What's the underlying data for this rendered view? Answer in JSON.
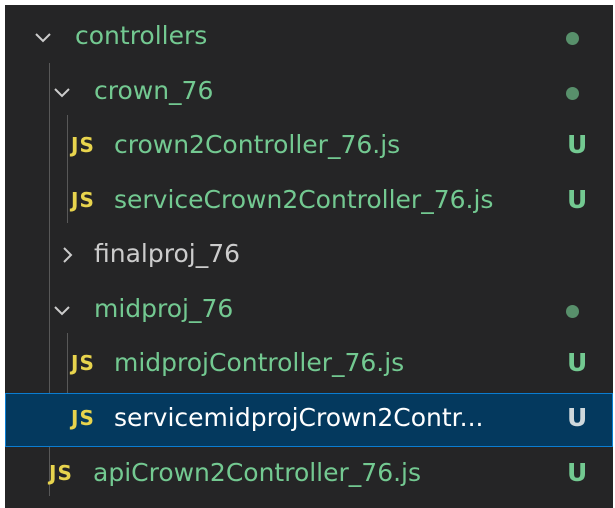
{
  "explorer": {
    "rows": [
      {
        "label": "controllers",
        "kind": "folder",
        "state": "expanded",
        "decoration": "dot"
      },
      {
        "label": "crown_76",
        "kind": "folder",
        "state": "expanded",
        "decoration": "dot"
      },
      {
        "icon": "JS",
        "label": "crown2Controller_76.js",
        "kind": "file",
        "decoration": "U"
      },
      {
        "icon": "JS",
        "label": "serviceCrown2Controller_76.js",
        "kind": "file",
        "decoration": "U"
      },
      {
        "label": "finalproj_76",
        "kind": "folder",
        "state": "collapsed",
        "decoration": ""
      },
      {
        "label": "midproj_76",
        "kind": "folder",
        "state": "expanded",
        "decoration": "dot"
      },
      {
        "icon": "JS",
        "label": "midprojController_76.js",
        "kind": "file",
        "decoration": "U"
      },
      {
        "icon": "JS",
        "label": "servicemidprojCrown2Contr...",
        "kind": "file",
        "decoration": "U",
        "selected": true
      },
      {
        "icon": "JS",
        "label": "apiCrown2Controller_76.js",
        "kind": "file",
        "decoration": "U"
      }
    ]
  },
  "colors": {
    "background": "#252526",
    "modified_green": "#73c991",
    "js_yellow": "#e8d44d",
    "selection": "#04395e",
    "selection_border": "#0b7dd1"
  }
}
